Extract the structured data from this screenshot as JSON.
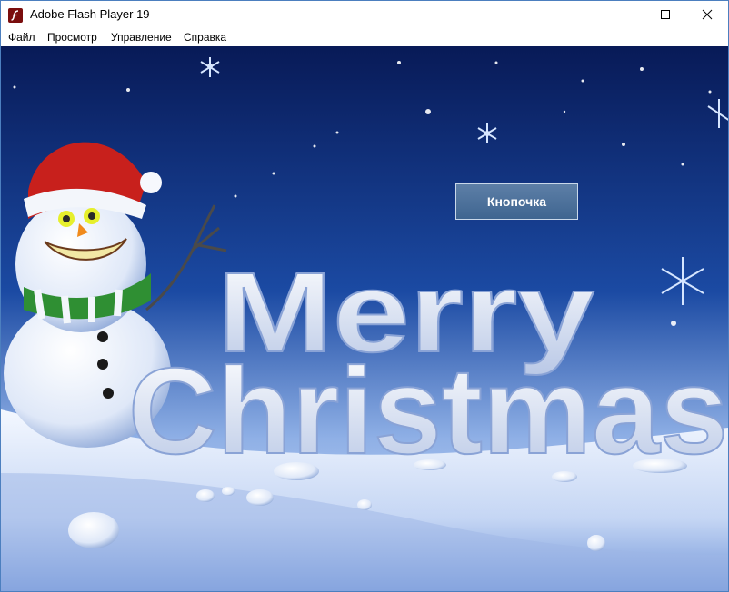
{
  "window": {
    "title": "Adobe Flash Player 19",
    "icon": "flash-player-icon",
    "controls": [
      "minimize-icon",
      "maximize-icon",
      "close-icon"
    ]
  },
  "menu": {
    "items": [
      "Файл",
      "Просмотр",
      "Управление",
      "Справка"
    ]
  },
  "stage": {
    "background": "merry-christmas-snowman-artwork",
    "headline_line1": "Merry",
    "headline_line2": "Christmas",
    "button_label": "Кнопочка"
  },
  "colors": {
    "sky_top": "#0c1f5c",
    "sky_bottom": "#b9c9ee",
    "snow": "#e6eefb",
    "button_top": "#5d7fa7",
    "button_bottom": "#3f6590"
  }
}
